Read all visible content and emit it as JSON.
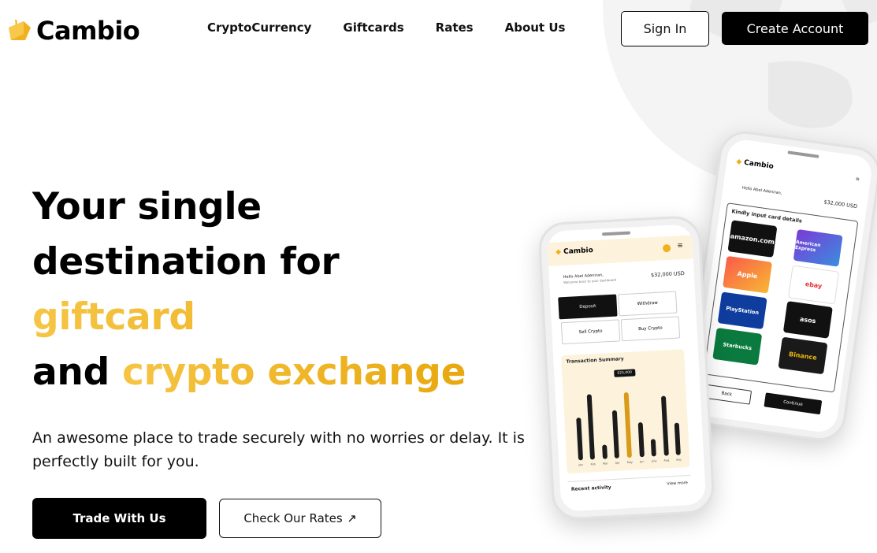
{
  "brand": {
    "name": "Cambio",
    "accent": "#f0b020"
  },
  "nav": [
    {
      "label": "CryptoCurrency"
    },
    {
      "label": "Giftcards"
    },
    {
      "label": "Rates"
    },
    {
      "label": "About Us"
    }
  ],
  "header": {
    "signin": "Sign In",
    "create": "Create Account"
  },
  "hero": {
    "line1": "Your single",
    "line2": "destination for",
    "line3": "giftcard",
    "line4_a": "and",
    "line4_b": "crypto exchange",
    "subtitle": "An awesome place to trade securely with no worries or delay. It is perfectly built for you.",
    "cta_primary": "Trade With Us",
    "cta_secondary": "Check Our Rates",
    "cta_secondary_icon": "external-link-icon"
  },
  "phone_front": {
    "logo": "Cambio",
    "greeting": "Hello Abel Adeniran,",
    "greeting_sub": "Welcome back to your dashboard",
    "balance": "$32,000 USD",
    "actions": [
      "Deposit",
      "Withdraw",
      "Sell Crypto",
      "Buy Crypto"
    ],
    "summary_title": "Transaction Summary",
    "tooltip": "$25,000",
    "months": [
      "Jan",
      "Feb",
      "Mar",
      "Apr",
      "May",
      "Jun",
      "July",
      "Aug",
      "Sep"
    ],
    "chart_values": [
      0.55,
      0.85,
      0.18,
      0.62,
      0.85,
      0.45,
      0.22,
      0.78,
      0.42
    ],
    "highlight_index": 4,
    "recent": "Recent activity",
    "view_more": "View more"
  },
  "phone_back": {
    "logo": "Cambio",
    "greeting": "Hello Abel Adeniran,",
    "balance": "$32,000 USD",
    "panel_title": "Kindly input card details",
    "cards": [
      "amazon.com",
      "American Express",
      "Apple",
      "ebay",
      "PlayStation",
      "asos",
      "Starbucks",
      "Binance"
    ],
    "back": "Back",
    "continue": "Continue"
  }
}
